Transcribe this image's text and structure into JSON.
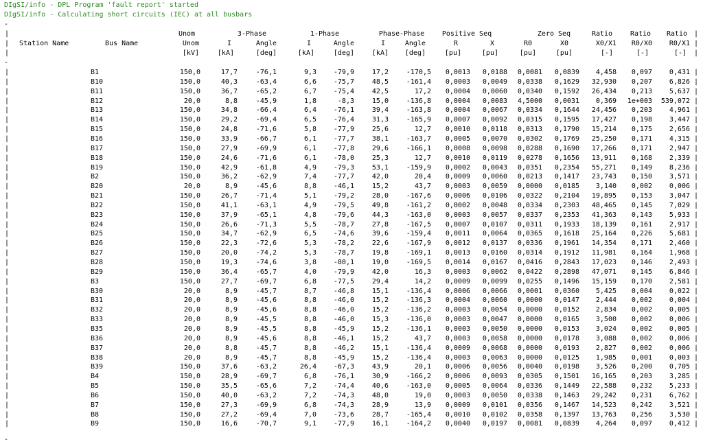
{
  "log": [
    "DIgSI/info - DPL Program 'fault report' started",
    "DIgSI/info - Calculating short circuits (IEC) at all busbars"
  ],
  "separator": "-",
  "column_separator": "|",
  "header": {
    "row1": [
      "",
      "",
      "Unom",
      "3-Phase",
      "1-Phase",
      "Phase-Phase",
      "Positive Seq",
      "Zero Seq",
      "Ratio",
      "Ratio",
      "Ratio"
    ],
    "row2": [
      "Station Name",
      "Bus Name",
      "Unom",
      "I",
      "Angle",
      "I",
      "Angle",
      "I",
      "Angle",
      "R",
      "X",
      "R0",
      "X0",
      "X0/X1",
      "R0/X0",
      "R0/X1"
    ],
    "row3": [
      "",
      "",
      "[kV]",
      "[kA]",
      "[deg]",
      "[kA]",
      "[deg]",
      "[kA]",
      "[deg]",
      "[pu]",
      "[pu]",
      "[pu]",
      "[pu]",
      "[-]",
      "[-]",
      "[-]"
    ]
  },
  "rows": [
    [
      "",
      "B1",
      "150,0",
      "17,7",
      "-76,1",
      "9,3",
      "-79,9",
      "17,2",
      "-170,5",
      "0,0013",
      "0,0188",
      "0,0081",
      "0,0839",
      "4,458",
      "0,097",
      "0,431"
    ],
    [
      "",
      "B10",
      "150,0",
      "40,3",
      "-63,4",
      "6,6",
      "-75,7",
      "48,5",
      "-161,4",
      "0,0003",
      "0,0049",
      "0,0338",
      "0,1629",
      "32,930",
      "0,207",
      "6,826"
    ],
    [
      "",
      "B11",
      "150,0",
      "36,7",
      "-65,2",
      "6,7",
      "-75,4",
      "42,5",
      "17,2",
      "0,0004",
      "0,0060",
      "0,0340",
      "0,1592",
      "26,434",
      "0,213",
      "5,637"
    ],
    [
      "",
      "B12",
      "20,0",
      "8,8",
      "-45,9",
      "1,8",
      "-8,3",
      "15,0",
      "-136,8",
      "0,0004",
      "0,0083",
      "4,5000",
      "0,0031",
      "0,369",
      "1e+003",
      "539,072"
    ],
    [
      "",
      "B13",
      "150,0",
      "34,8",
      "-66,4",
      "6,4",
      "-76,1",
      "39,4",
      "-163,8",
      "0,0004",
      "0,0067",
      "0,0334",
      "0,1644",
      "24,456",
      "0,203",
      "4,961"
    ],
    [
      "",
      "B14",
      "150,0",
      "29,2",
      "-69,4",
      "6,5",
      "-76,4",
      "31,3",
      "-165,9",
      "0,0007",
      "0,0092",
      "0,0315",
      "0,1595",
      "17,427",
      "0,198",
      "3,447"
    ],
    [
      "",
      "B15",
      "150,0",
      "24,8",
      "-71,6",
      "5,8",
      "-77,9",
      "25,6",
      "12,7",
      "0,0010",
      "0,0118",
      "0,0313",
      "0,1790",
      "15,214",
      "0,175",
      "2,656"
    ],
    [
      "",
      "B16",
      "150,0",
      "33,9",
      "-66,7",
      "6,1",
      "-77,7",
      "38,1",
      "-163,7",
      "0,0005",
      "0,0070",
      "0,0302",
      "0,1769",
      "25,250",
      "0,171",
      "4,315"
    ],
    [
      "",
      "B17",
      "150,0",
      "27,9",
      "-69,9",
      "6,1",
      "-77,8",
      "29,6",
      "-166,1",
      "0,0008",
      "0,0098",
      "0,0288",
      "0,1690",
      "17,266",
      "0,171",
      "2,947"
    ],
    [
      "",
      "B18",
      "150,0",
      "24,6",
      "-71,6",
      "6,1",
      "-78,0",
      "25,3",
      "12,7",
      "0,0010",
      "0,0119",
      "0,0278",
      "0,1656",
      "13,911",
      "0,168",
      "2,339"
    ],
    [
      "",
      "B19",
      "150,0",
      "42,9",
      "-61,8",
      "4,9",
      "-79,3",
      "53,1",
      "-159,9",
      "0,0002",
      "0,0043",
      "0,0351",
      "0,2354",
      "55,271",
      "0,149",
      "8,236"
    ],
    [
      "",
      "B2",
      "150,0",
      "36,2",
      "-62,9",
      "7,4",
      "-77,7",
      "42,0",
      "20,4",
      "0,0009",
      "0,0060",
      "0,0213",
      "0,1417",
      "23,743",
      "0,150",
      "3,571"
    ],
    [
      "",
      "B20",
      "20,0",
      "8,9",
      "-45,6",
      "8,8",
      "-46,1",
      "15,2",
      "43,7",
      "0,0003",
      "0,0059",
      "0,0000",
      "0,0185",
      "3,140",
      "0,002",
      "0,006"
    ],
    [
      "",
      "B21",
      "150,0",
      "26,7",
      "-71,4",
      "5,1",
      "-79,2",
      "28,0",
      "-167,6",
      "0,0006",
      "0,0106",
      "0,0322",
      "0,2104",
      "19,895",
      "0,153",
      "3,047"
    ],
    [
      "",
      "B22",
      "150,0",
      "41,1",
      "-63,1",
      "4,9",
      "-79,5",
      "49,8",
      "-161,2",
      "0,0002",
      "0,0048",
      "0,0334",
      "0,2303",
      "48,465",
      "0,145",
      "7,029"
    ],
    [
      "",
      "B23",
      "150,0",
      "37,9",
      "-65,1",
      "4,8",
      "-79,6",
      "44,3",
      "-163,0",
      "0,0003",
      "0,0057",
      "0,0337",
      "0,2353",
      "41,363",
      "0,143",
      "5,933"
    ],
    [
      "",
      "B24",
      "150,0",
      "26,6",
      "-71,3",
      "5,5",
      "-78,7",
      "27,8",
      "-167,5",
      "0,0007",
      "0,0107",
      "0,0311",
      "0,1933",
      "18,139",
      "0,161",
      "2,917"
    ],
    [
      "",
      "B25",
      "150,0",
      "34,7",
      "-62,9",
      "6,5",
      "-74,6",
      "39,6",
      "-159,4",
      "0,0011",
      "0,0064",
      "0,0365",
      "0,1618",
      "25,164",
      "0,226",
      "5,681"
    ],
    [
      "",
      "B26",
      "150,0",
      "22,3",
      "-72,6",
      "5,3",
      "-78,2",
      "22,6",
      "-167,9",
      "0,0012",
      "0,0137",
      "0,0336",
      "0,1961",
      "14,354",
      "0,171",
      "2,460"
    ],
    [
      "",
      "B27",
      "150,0",
      "20,0",
      "-74,2",
      "5,3",
      "-78,7",
      "19,8",
      "-169,1",
      "0,0013",
      "0,0160",
      "0,0314",
      "0,1912",
      "11,981",
      "0,164",
      "1,968"
    ],
    [
      "",
      "B28",
      "150,0",
      "19,3",
      "-74,6",
      "3,8",
      "-80,1",
      "19,0",
      "-169,5",
      "0,0014",
      "0,0167",
      "0,0416",
      "0,2843",
      "17,023",
      "0,146",
      "2,493"
    ],
    [
      "",
      "B29",
      "150,0",
      "36,4",
      "-65,7",
      "4,0",
      "-79,9",
      "42,0",
      "16,3",
      "0,0003",
      "0,0062",
      "0,0422",
      "0,2898",
      "47,071",
      "0,145",
      "6,846"
    ],
    [
      "",
      "B3",
      "150,0",
      "27,7",
      "-69,7",
      "6,8",
      "-77,5",
      "29,4",
      "14,2",
      "0,0009",
      "0,0099",
      "0,0255",
      "0,1496",
      "15,159",
      "0,170",
      "2,581"
    ],
    [
      "",
      "B30",
      "20,0",
      "8,9",
      "-45,7",
      "8,7",
      "-46,8",
      "15,1",
      "-136,4",
      "0,0006",
      "0,0066",
      "0,0001",
      "0,0360",
      "5,425",
      "0,004",
      "0,022"
    ],
    [
      "",
      "B31",
      "20,0",
      "8,9",
      "-45,6",
      "8,8",
      "-46,0",
      "15,2",
      "-136,3",
      "0,0004",
      "0,0060",
      "0,0000",
      "0,0147",
      "2,444",
      "0,002",
      "0,004"
    ],
    [
      "",
      "B32",
      "20,0",
      "8,9",
      "-45,6",
      "8,8",
      "-46,0",
      "15,2",
      "-136,2",
      "0,0003",
      "0,0054",
      "0,0000",
      "0,0152",
      "2,834",
      "0,002",
      "0,005"
    ],
    [
      "",
      "B33",
      "20,0",
      "8,9",
      "-45,5",
      "8,8",
      "-46,0",
      "15,3",
      "-136,0",
      "0,0003",
      "0,0047",
      "0,0000",
      "0,0165",
      "3,500",
      "0,002",
      "0,006"
    ],
    [
      "",
      "B35",
      "20,0",
      "8,9",
      "-45,5",
      "8,8",
      "-45,9",
      "15,2",
      "-136,1",
      "0,0003",
      "0,0050",
      "0,0000",
      "0,0153",
      "3,024",
      "0,002",
      "0,005"
    ],
    [
      "",
      "B36",
      "20,0",
      "8,9",
      "-45,6",
      "8,8",
      "-46,1",
      "15,2",
      "43,7",
      "0,0003",
      "0,0058",
      "0,0000",
      "0,0178",
      "3,088",
      "0,002",
      "0,006"
    ],
    [
      "",
      "B37",
      "20,0",
      "8,8",
      "-45,7",
      "8,8",
      "-46,2",
      "15,1",
      "-136,4",
      "0,0009",
      "0,0068",
      "0,0000",
      "0,0193",
      "2,827",
      "0,002",
      "0,006"
    ],
    [
      "",
      "B38",
      "20,0",
      "8,9",
      "-45,7",
      "8,8",
      "-45,9",
      "15,2",
      "-136,4",
      "0,0003",
      "0,0063",
      "0,0000",
      "0,0125",
      "1,985",
      "0,001",
      "0,003"
    ],
    [
      "",
      "B39",
      "150,0",
      "37,6",
      "-63,2",
      "26,4",
      "-67,3",
      "43,9",
      "20,1",
      "0,0006",
      "0,0056",
      "0,0040",
      "0,0198",
      "3,526",
      "0,200",
      "0,705"
    ],
    [
      "",
      "B4",
      "150,0",
      "28,9",
      "-69,7",
      "6,8",
      "-76,1",
      "30,9",
      "-166,2",
      "0,0006",
      "0,0093",
      "0,0305",
      "0,1501",
      "16,165",
      "0,203",
      "3,285"
    ],
    [
      "",
      "B5",
      "150,0",
      "35,5",
      "-65,6",
      "7,2",
      "-74,4",
      "40,6",
      "-163,0",
      "0,0005",
      "0,0064",
      "0,0336",
      "0,1449",
      "22,588",
      "0,232",
      "5,233"
    ],
    [
      "",
      "B6",
      "150,0",
      "40,0",
      "-63,2",
      "7,2",
      "-74,3",
      "48,0",
      "19,0",
      "0,0003",
      "0,0050",
      "0,0338",
      "0,1463",
      "29,242",
      "0,231",
      "6,762"
    ],
    [
      "",
      "B7",
      "150,0",
      "27,3",
      "-69,9",
      "6,8",
      "-74,3",
      "28,9",
      "13,9",
      "0,0009",
      "0,0101",
      "0,0356",
      "0,1467",
      "14,523",
      "0,242",
      "3,521"
    ],
    [
      "",
      "B8",
      "150,0",
      "27,2",
      "-69,4",
      "7,0",
      "-73,6",
      "28,7",
      "-165,4",
      "0,0010",
      "0,0102",
      "0,0358",
      "0,1397",
      "13,763",
      "0,256",
      "3,530"
    ],
    [
      "",
      "B9",
      "150,0",
      "16,6",
      "-70,7",
      "9,1",
      "-77,9",
      "16,1",
      "-164,2",
      "0,0040",
      "0,0197",
      "0,0081",
      "0,0839",
      "4,264",
      "0,097",
      "0,412"
    ]
  ]
}
